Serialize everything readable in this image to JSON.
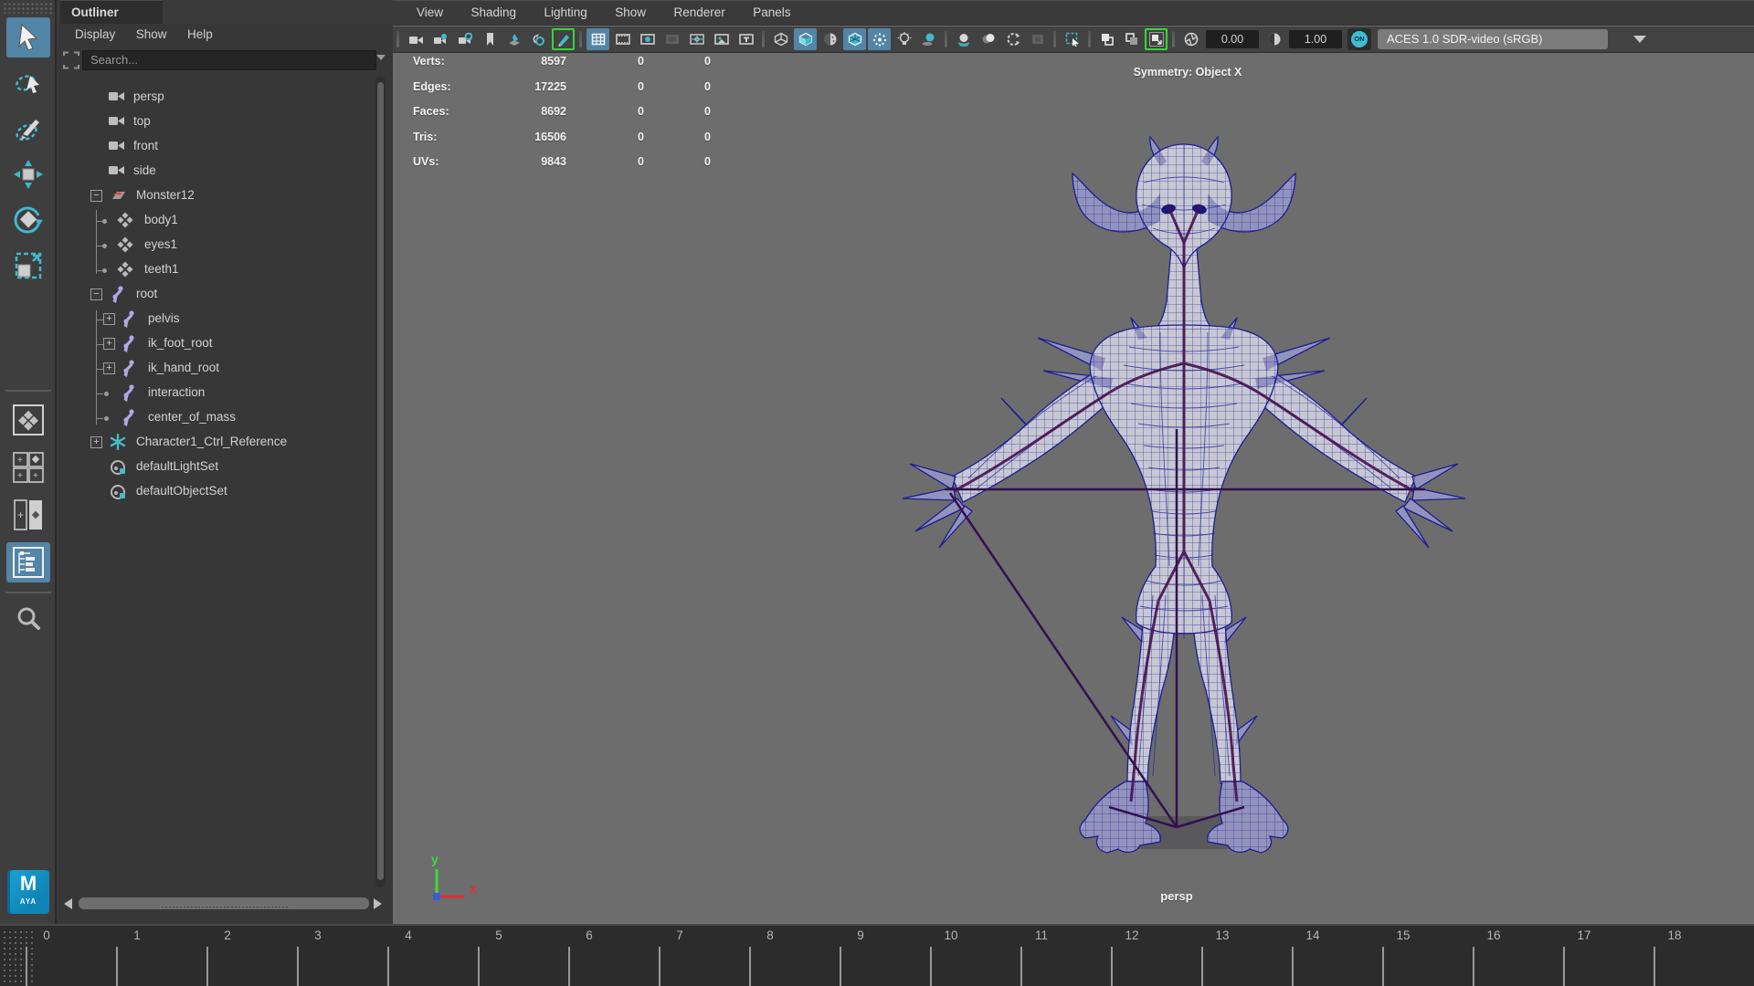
{
  "sidebar": {
    "tools": [
      {
        "name": "select-tool",
        "active": true
      },
      {
        "name": "lasso-select-tool",
        "active": false
      },
      {
        "name": "paint-select-tool",
        "active": false
      },
      {
        "name": "move-tool",
        "active": false
      },
      {
        "name": "rotate-tool",
        "active": false
      },
      {
        "name": "scale-tool",
        "active": false
      }
    ],
    "layouts": [
      {
        "name": "layout-single-pane",
        "active": false
      },
      {
        "name": "layout-four-pane",
        "active": false
      },
      {
        "name": "layout-two-pane",
        "active": false
      },
      {
        "name": "layout-outliner-persp",
        "active": true
      }
    ],
    "zoom_tool": "zoom-tool",
    "logo_m": "M",
    "logo_aya": "AYA"
  },
  "outliner": {
    "tab": "Outliner",
    "menus": [
      "Display",
      "Show",
      "Help"
    ],
    "search_placeholder": "Search...",
    "items": [
      {
        "label": "persp",
        "icon": "camera",
        "kind": "top"
      },
      {
        "label": "top",
        "icon": "camera",
        "kind": "top"
      },
      {
        "label": "front",
        "icon": "camera",
        "kind": "top"
      },
      {
        "label": "side",
        "icon": "camera",
        "kind": "top"
      },
      {
        "label": "Monster12",
        "icon": "transform",
        "kind": "parent",
        "expand": "minus"
      },
      {
        "label": "body1",
        "icon": "mesh",
        "kind": "child"
      },
      {
        "label": "eyes1",
        "icon": "mesh",
        "kind": "child"
      },
      {
        "label": "teeth1",
        "icon": "mesh",
        "kind": "child"
      },
      {
        "label": "root",
        "icon": "joint",
        "kind": "parent",
        "expand": "minus"
      },
      {
        "label": "pelvis",
        "icon": "joint",
        "kind": "gchild",
        "expand": "plus"
      },
      {
        "label": "ik_foot_root",
        "icon": "joint",
        "kind": "gchild",
        "expand": "plus"
      },
      {
        "label": "ik_hand_root",
        "icon": "joint",
        "kind": "gchild",
        "expand": "plus"
      },
      {
        "label": "interaction",
        "icon": "joint",
        "kind": "gchild"
      },
      {
        "label": "center_of_mass",
        "icon": "joint",
        "kind": "gchild"
      },
      {
        "label": "Character1_Ctrl_Reference",
        "icon": "asterisk",
        "kind": "parent",
        "expand": "plus"
      },
      {
        "label": "defaultLightSet",
        "icon": "set",
        "kind": "set"
      },
      {
        "label": "defaultObjectSet",
        "icon": "set",
        "kind": "set"
      }
    ]
  },
  "viewport": {
    "menus": [
      "View",
      "Shading",
      "Lighting",
      "Show",
      "Renderer",
      "Panels"
    ],
    "toolbar": {
      "items": [
        {
          "t": "icon",
          "name": "camera-icon"
        },
        {
          "t": "icon",
          "name": "camera-lock-icon"
        },
        {
          "t": "icon",
          "name": "camera-attributes-icon"
        },
        {
          "t": "icon",
          "name": "bookmark-icon"
        },
        {
          "t": "icon",
          "name": "image-plane-icon"
        },
        {
          "t": "icon",
          "name": "two-d-pan-zoom-icon"
        },
        {
          "t": "icon",
          "name": "grease-pencil-icon",
          "state": "green"
        },
        {
          "t": "sep"
        },
        {
          "t": "icon",
          "name": "grid-icon",
          "state": "active"
        },
        {
          "t": "icon",
          "name": "film-gate-icon"
        },
        {
          "t": "icon",
          "name": "resolution-gate-icon"
        },
        {
          "t": "icon",
          "name": "gate-mask-icon",
          "state": "dim"
        },
        {
          "t": "icon",
          "name": "field-chart-icon"
        },
        {
          "t": "icon",
          "name": "safe-action-icon"
        },
        {
          "t": "icon",
          "name": "safe-title-icon"
        },
        {
          "t": "sep"
        },
        {
          "t": "icon",
          "name": "wireframe-icon"
        },
        {
          "t": "icon",
          "name": "shaded-icon",
          "state": "active"
        },
        {
          "t": "icon",
          "name": "textured-icon"
        },
        {
          "t": "icon",
          "name": "wireframe-on-shaded-icon",
          "state": "active"
        },
        {
          "t": "icon",
          "name": "default-material-icon",
          "state": "active"
        },
        {
          "t": "icon",
          "name": "lighting-icon"
        },
        {
          "t": "icon",
          "name": "shadows-icon"
        },
        {
          "t": "sep"
        },
        {
          "t": "icon",
          "name": "ambient-occlusion-icon"
        },
        {
          "t": "icon",
          "name": "motion-blur-icon"
        },
        {
          "t": "icon",
          "name": "anti-aliasing-icon"
        },
        {
          "t": "icon",
          "name": "depth-of-field-icon",
          "state": "dim"
        },
        {
          "t": "sep"
        },
        {
          "t": "icon",
          "name": "isolate-select-icon"
        },
        {
          "t": "sep"
        },
        {
          "t": "icon",
          "name": "xray-icon"
        },
        {
          "t": "icon",
          "name": "xray-joints-icon"
        },
        {
          "t": "icon",
          "name": "xray-active-icon",
          "state": "green"
        },
        {
          "t": "sep"
        },
        {
          "t": "icon",
          "name": "exposure-icon"
        },
        {
          "t": "field",
          "name": "exposure-field",
          "value": "0.00"
        },
        {
          "t": "icon",
          "name": "gamma-icon"
        },
        {
          "t": "field",
          "name": "gamma-field",
          "value": "1.00"
        },
        {
          "t": "toggle",
          "name": "color-managed-toggle",
          "label": "ON"
        },
        {
          "t": "dropdown",
          "name": "colorspace-dropdown",
          "label": "ACES 1.0 SDR-video (sRGB)"
        },
        {
          "t": "caret"
        }
      ]
    },
    "hud": {
      "rows": [
        {
          "label": "Verts:",
          "c1": "8597",
          "c2": "0",
          "c3": "0"
        },
        {
          "label": "Edges:",
          "c1": "17225",
          "c2": "0",
          "c3": "0"
        },
        {
          "label": "Faces:",
          "c1": "8692",
          "c2": "0",
          "c3": "0"
        },
        {
          "label": "Tris:",
          "c1": "16506",
          "c2": "0",
          "c3": "0"
        },
        {
          "label": "UVs:",
          "c1": "9843",
          "c2": "0",
          "c3": "0"
        }
      ],
      "symmetry": "Symmetry: Object X",
      "camera_label": "persp"
    },
    "axis": {
      "x": "x",
      "y": "y"
    }
  },
  "timeline": {
    "frames": [
      "0",
      "1",
      "2",
      "3",
      "4",
      "5",
      "6",
      "7",
      "8",
      "9",
      "10",
      "11",
      "12",
      "13",
      "14",
      "15",
      "16",
      "17",
      "18"
    ]
  },
  "colors": {
    "accent_blue": "#5285a6",
    "teal": "#3fb9cc",
    "wireframe_navy": "#1d1d92",
    "skeleton_purple": "#471150",
    "ik_purple": "#33104f",
    "viewport_gray": "#6d6d6d",
    "panel_dark": "#373737",
    "green_outline": "#37d437"
  }
}
